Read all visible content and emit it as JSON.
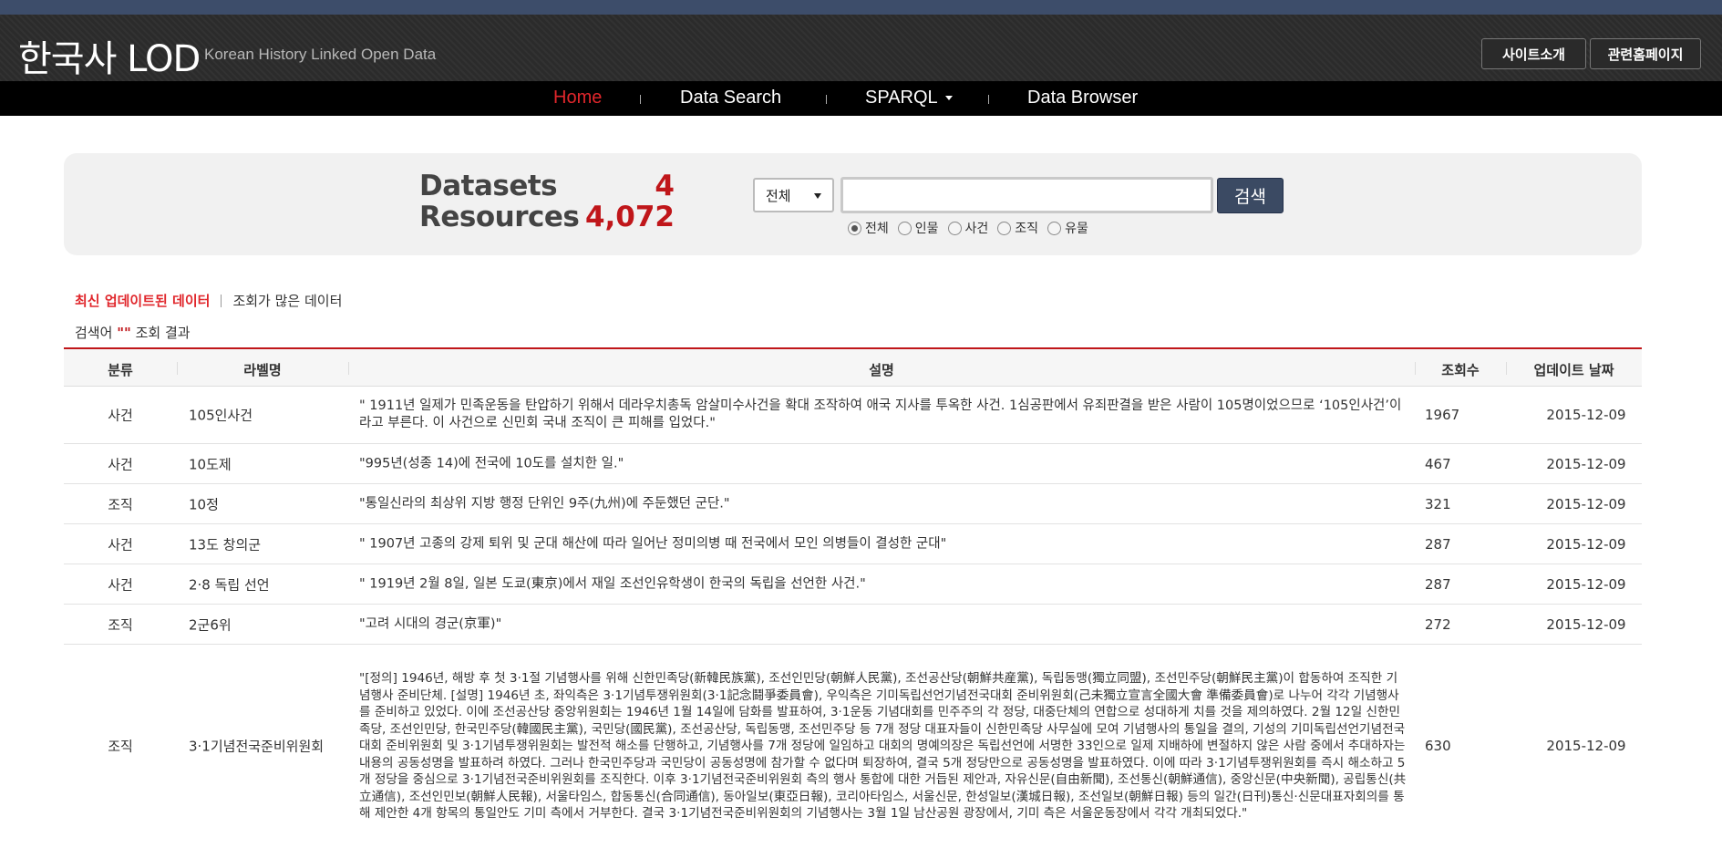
{
  "header": {
    "logo": "한국사 LOD",
    "subtitle": "Korean History Linked Open Data",
    "buttons": [
      "사이트소개",
      "관련홈페이지"
    ]
  },
  "nav": {
    "items": [
      "Home",
      "Data Search",
      "SPARQL",
      "Data Browser"
    ],
    "active": "Home"
  },
  "stats": {
    "datasets_label": "Datasets",
    "datasets_value": "4",
    "resources_label": "Resources",
    "resources_value": "4,072"
  },
  "search": {
    "select_value": "전체",
    "input_value": "",
    "button_label": "검색",
    "radio_options": [
      "전체",
      "인물",
      "사건",
      "조직",
      "유물"
    ],
    "radio_selected": "전체"
  },
  "tabs": {
    "active": "최신 업데이트된 데이터",
    "other": "조회가 많은 데이터"
  },
  "result": {
    "prefix": "검색어",
    "query": "\"\"",
    "suffix": "조회 결과"
  },
  "table": {
    "headers": [
      "분류",
      "라벨명",
      "설명",
      "조회수",
      "업데이트 날짜"
    ],
    "rows": [
      {
        "category": "사건",
        "label": "105인사건",
        "description": "\" 1911년 일제가 민족운동을 탄압하기 위해서 데라우치총독 암살미수사건을 확대 조작하여 애국 지사를 투옥한 사건. 1심공판에서 유죄판결을 받은 사람이 105명이었으므로 ‘105인사건’이라고 부른다. 이 사건으로 신민회 국내 조직이 큰 피해를 입었다.\"",
        "views": "1967",
        "date": "2015-12-09"
      },
      {
        "category": "사건",
        "label": "10도제",
        "description": "\"995년(성종 14)에 전국에 10도를 설치한 일.\"",
        "views": "467",
        "date": "2015-12-09"
      },
      {
        "category": "조직",
        "label": "10정",
        "description": "\"통일신라의 최상위 지방 행정 단위인 9주(九州)에 주둔했던 군단.\"",
        "views": "321",
        "date": "2015-12-09"
      },
      {
        "category": "사건",
        "label": "13도 창의군",
        "description": "\" 1907년 고종의 강제 퇴위 및 군대 해산에 따라 일어난 정미의병 때 전국에서 모인 의병들이 결성한 군대\"",
        "views": "287",
        "date": "2015-12-09"
      },
      {
        "category": "사건",
        "label": "2·8 독립 선언",
        "description": "\" 1919년 2월 8일, 일본 도쿄(東京)에서 재일 조선인유학생이 한국의 독립을 선언한 사건.\"",
        "views": "287",
        "date": "2015-12-09"
      },
      {
        "category": "조직",
        "label": "2군6위",
        "description": "\"고려 시대의 경군(京軍)\"",
        "views": "272",
        "date": "2015-12-09"
      },
      {
        "category": "조직",
        "label": "3·1기념전국준비위원회",
        "description": "\"[정의] 1946년, 해방 후 첫 3·1절 기념행사를 위해 신한민족당(新韓民族黨), 조선인민당(朝鮮人民黨), 조선공산당(朝鮮共産黨), 독립동맹(獨立同盟), 조선민주당(朝鮮民主黨)이 합동하여 조직한 기념행사 준비단체. [설명] 1946년 초, 좌익측은 3·1기념투쟁위원회(3·1記念鬪爭委員會), 우익측은 기미독립선언기념전국대회 준비위원회(己未獨立宣言全國大會 準備委員會)로 나누어 각각 기념행사를 준비하고 있었다. 이에 조선공산당 중앙위원회는 1946년 1월 14일에 담화를 발표하여, 3·1운동 기념대회를 민주주의 각 정당, 대중단체의 연합으로 성대하게 치를 것을 제의하였다. 2월 12일 신한민족당, 조선인민당, 한국민주당(韓國民主黨), 국민당(國民黨), 조선공산당, 독립동맹, 조선민주당 등 7개 정당 대표자들이 신한민족당 사무실에 모여 기념행사의 통일을 결의, 기성의 기미독립선언기념전국대회 준비위원회 및 3·1기념투쟁위원회는 발전적 해소를 단행하고, 기념행사를 7개 정당에 일임하고 대회의 명예의장은 독립선언에 서명한 33인으로 일제 지배하에 변절하지 않은 사람 중에서 추대하자는 내용의 공동성명을 발표하려 하였다. 그러나 한국민주당과 국민당이 공동성명에 참가할 수 없다며 퇴장하여, 결국 5개 정당만으로 공동성명을 발표하였다. 이에 따라 3·1기념투쟁위원회를 즉시 해소하고 5개 정당을 중심으로 3·1기념전국준비위원회를 조직한다. 이후 3·1기념전국준비위원회 측의 행사 통합에 대한 거듭된 제안과, 자유신문(自由新聞), 조선통신(朝鮮通信), 중앙신문(中央新聞), 공립통신(共立通信), 조선인민보(朝鮮人民報), 서울타임스, 합동통신(合同通信), 동아일보(東亞日報), 코리아타임스, 서울신문, 한성일보(漢城日報), 조선일보(朝鮮日報) 등의 일간(日刊)통신·신문대표자회의를 통해 제안한 4개 항목의 통일안도 기미 측에서 거부한다. 결국 3·1기념전국준비위원회의 기념행사는 3월 1일 남산공원 광장에서, 기미 측은 서울운동장에서 각각 개최되었다.\"",
        "views": "630",
        "date": "2015-12-09"
      }
    ]
  }
}
